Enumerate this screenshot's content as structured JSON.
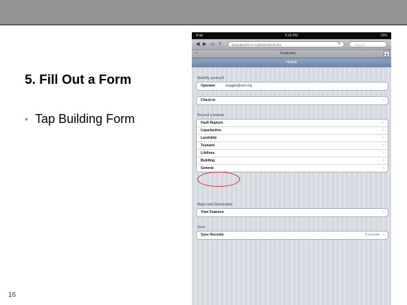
{
  "slide": {
    "title": "5. Fill Out a Form",
    "bullet": "Tap Building Form",
    "page_number": "16"
  },
  "ipad": {
    "status": {
      "carrier": "iPad",
      "time": "5:29 PM",
      "battery": "79%"
    },
    "browser": {
      "url": "ilasquakesforce.org/fieldnotes/home",
      "search_placeholder": "Search",
      "tab_title": "Fieldnotes",
      "add_tab": "+"
    },
    "header": {
      "title": "Home"
    },
    "identify": {
      "label": "Identify yourself",
      "operator_label": "Operator",
      "operator_value": "maggie@eeri.org",
      "checkin_label": "Check-in"
    },
    "record": {
      "label": "Record a feature",
      "items": [
        "Fault Rupture",
        "Liquefaction",
        "Landslide",
        "Tsunami",
        "Lifelines",
        "Building",
        "General"
      ]
    },
    "maps": {
      "label": "Maps and Downloads",
      "view_features": "View Features"
    },
    "sync": {
      "label": "Sync",
      "sync_records": "Sync Records",
      "records_count": "0 records"
    }
  },
  "colors": {
    "title_bar": "#969696",
    "app_header": "#7a91b3",
    "highlight": "#d12121"
  }
}
